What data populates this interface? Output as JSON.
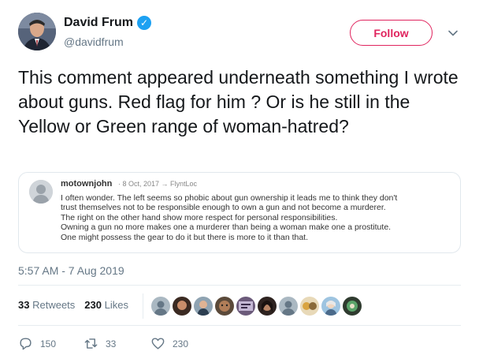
{
  "author": {
    "name": "David Frum",
    "handle": "@davidfrum",
    "verified_icon": "verified-check-icon"
  },
  "header": {
    "follow_label": "Follow",
    "menu_icon": "chevron-down-icon"
  },
  "tweet": {
    "text": "This comment appeared underneath something I wrote about guns. Red flag for him ? Or is he still in the Yellow or Green range of woman-hatred?",
    "timestamp": "5:57 AM - 7 Aug 2019"
  },
  "embedded_comment": {
    "username": "motownjohn",
    "meta": "· 8 Oct, 2017 → FlyntLoc",
    "lines": [
      "I often wonder. The left seems so phobic about gun ownership it leads me to think they don't",
      "trust themselves not to be responsible enough to own a gun and not become a murderer.",
      "The right on the other hand show more respect for personal responsibilities.",
      "Owning a gun no more makes one a murderer than being a woman make one a prostitute.",
      "One might possess the gear to do it but there is more to it than that."
    ]
  },
  "stats": {
    "retweets_count": "33",
    "retweets_label": "Retweets",
    "likes_count": "230",
    "likes_label": "Likes"
  },
  "actions": {
    "replies": "150",
    "retweets": "33",
    "likes": "230"
  },
  "colors": {
    "follow_accent": "#e0245e",
    "verified": "#1da1f2",
    "secondary_text": "#657786"
  }
}
